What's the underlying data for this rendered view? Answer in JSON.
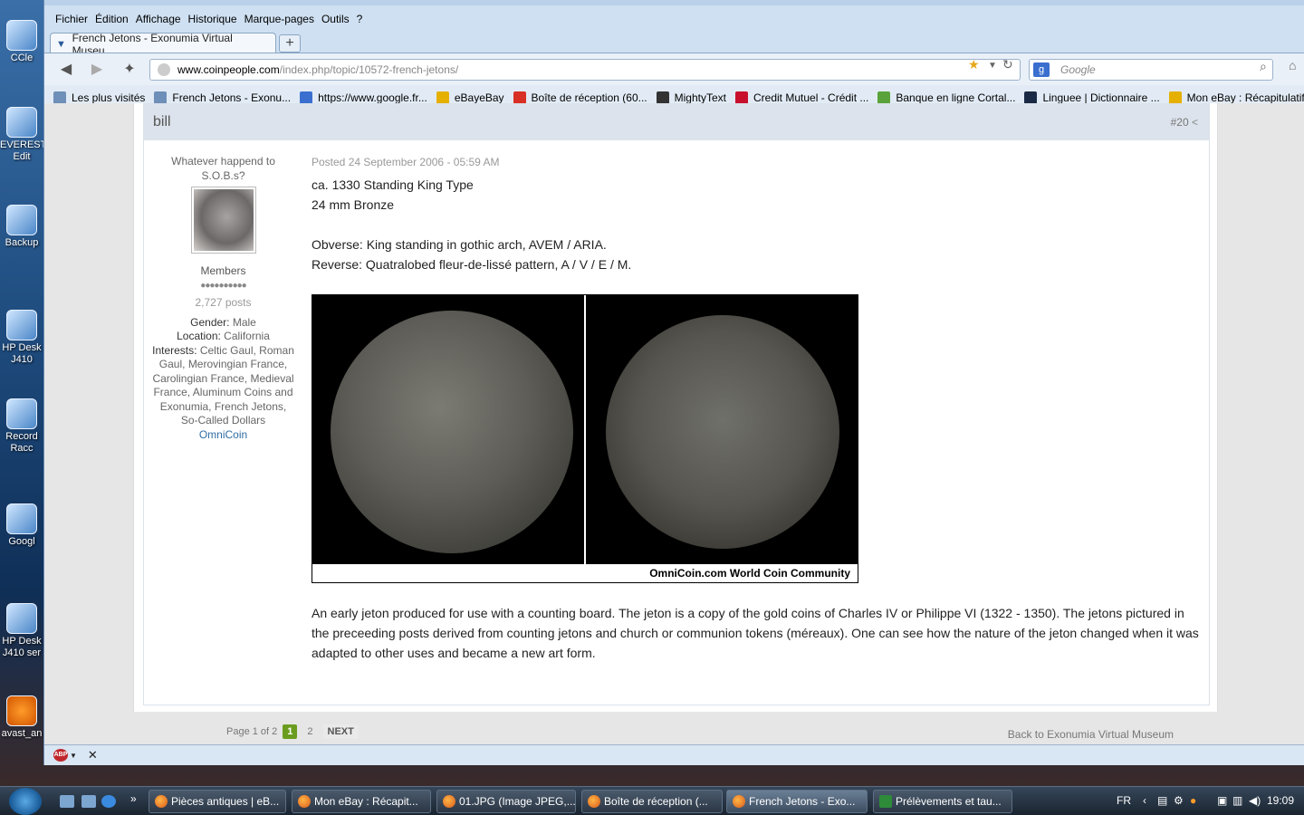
{
  "window": {
    "title": "French Jetons - Exonumia Virtual Museum - Coin Community - Mozilla Firefox"
  },
  "menu": [
    "Fichier",
    "Édition",
    "Affichage",
    "Historique",
    "Marque-pages",
    "Outils",
    "?"
  ],
  "tab": {
    "label": "French Jetons - Exonumia Virtual Museu...",
    "new_tab": "+"
  },
  "address": {
    "domain": "www.coinpeople.com",
    "path": "/index.php/topic/10572-french-jetons/"
  },
  "search": {
    "placeholder": "Google",
    "engine_badge": "g"
  },
  "bookmarks": [
    "Les plus visités",
    "French Jetons - Exonu...",
    "https://www.google.fr...",
    "eBayeBay",
    "Boîte de réception (60...",
    "MightyText",
    "Credit Mutuel - Crédit ...",
    "Banque en ligne Cortal...",
    "Linguee | Dictionnaire ...",
    "Mon eBay : Récapitulatif"
  ],
  "post": {
    "author": "bill",
    "number": "#20",
    "author_title": "Whatever happend to S.O.B.s?",
    "group": "Members",
    "pips": "●●●●●●●●●●",
    "post_count": "2,727 posts",
    "gender_label": "Gender:",
    "gender": "Male",
    "location_label": "Location:",
    "location": "California",
    "interests_label": "Interests:",
    "interests": "Celtic Gaul, Roman Gaul, Merovingian France, Carolingian France, Medieval France, Aluminum Coins and Exonumia, French Jetons, So-Called Dollars",
    "website": "OmniCoin",
    "date": "Posted 24 September 2006 - 05:59 AM",
    "line1": "ca. 1330 Standing King Type",
    "line2": "24 mm Bronze",
    "obverse": "Obverse: King standing in gothic arch, AVEM / ARIA.",
    "reverse": "Reverse: Quatralobed fleur-de-lissé pattern, A / V / E / M.",
    "image_caption": "OmniCoin.com World Coin Community",
    "body": "An early jeton produced for use with a counting board. The jeton is a copy of the gold coins of Charles IV or Philippe VI (1322 - 1350). The jetons pictured in the preceeding posts derived from counting jetons and church or communion tokens (méreaux). One can see how the nature of the jeton changed when it was adapted to other uses and became a new art form."
  },
  "pagination": {
    "label": "Page 1 of 2",
    "pages": [
      "1",
      "2"
    ],
    "next": "NEXT",
    "back": "Back to Exonumia Virtual Museum"
  },
  "desktop_icons": [
    "CCle",
    "EVEREST Edit",
    "Backup",
    "HP Desk J410",
    "Record Racc",
    "Googl",
    "HP Desk J410 ser",
    "avast_an"
  ],
  "taskbar": {
    "tasks": [
      "Pièces antiques | eB...",
      "Mon eBay : Récapit...",
      "01.JPG (Image JPEG,...",
      "Boîte de réception (...",
      "French Jetons - Exo...",
      "Prélèvements et tau..."
    ],
    "lang": "FR",
    "clock": "19:09"
  }
}
